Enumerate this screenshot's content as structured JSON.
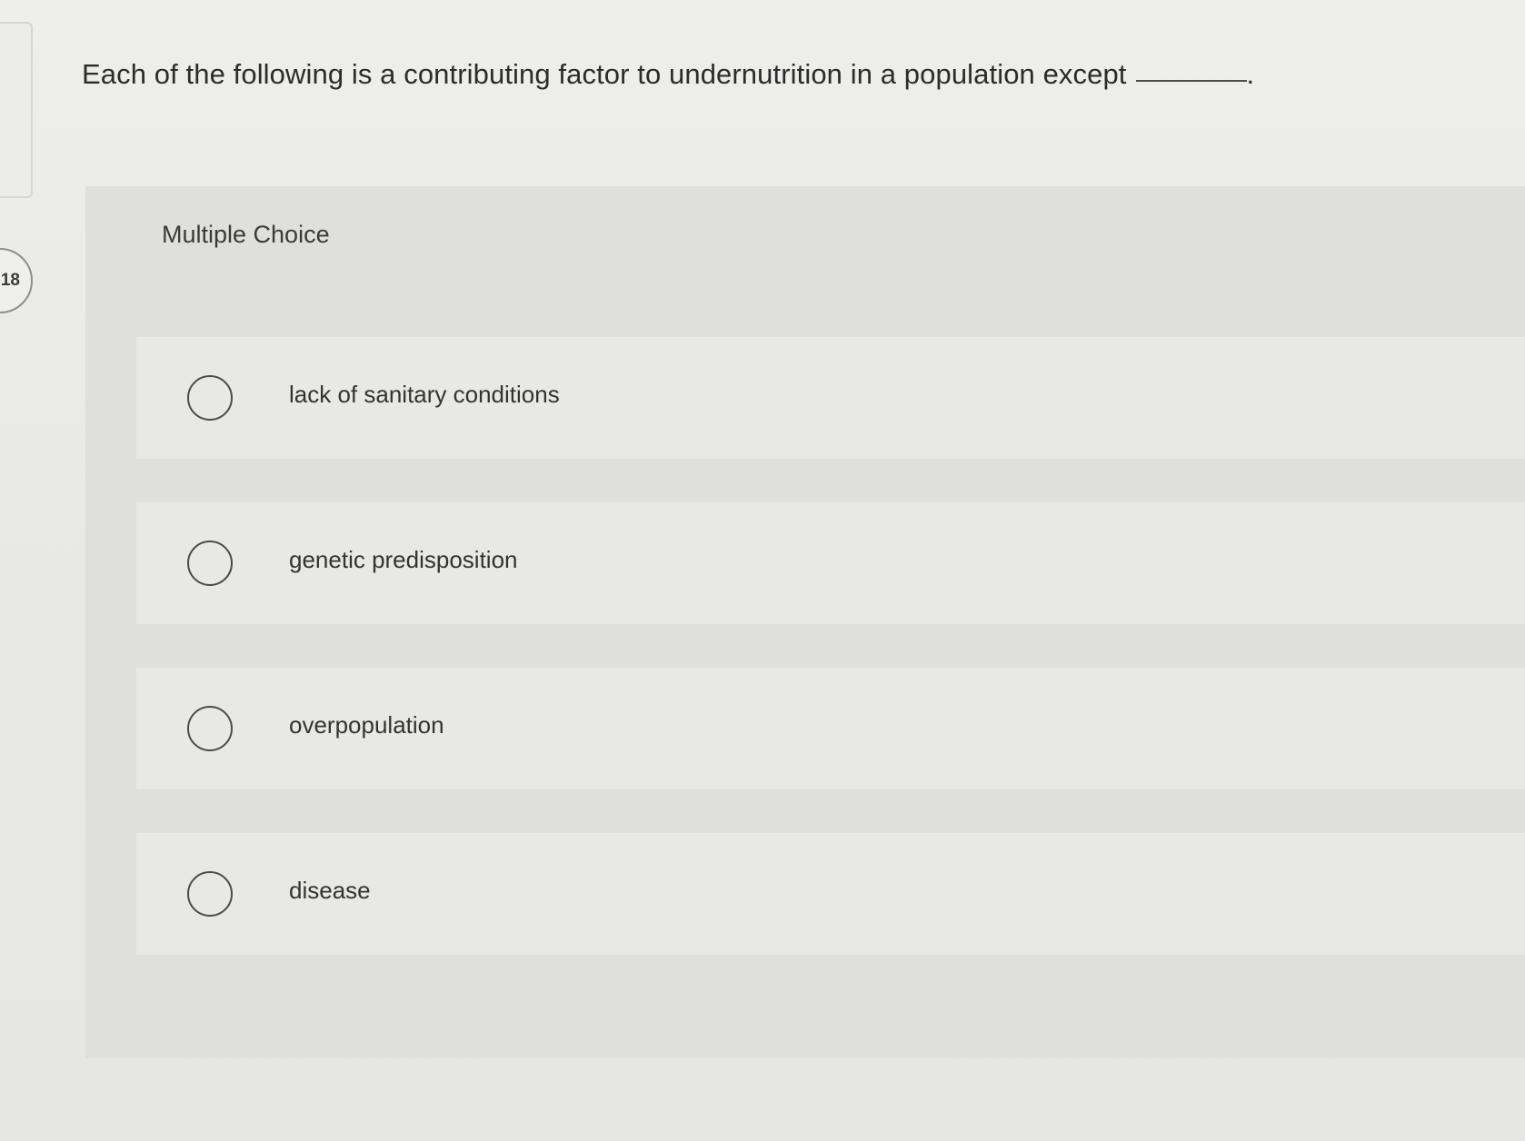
{
  "question": {
    "number": "18",
    "text": "Each of the following is a contributing factor to undernutrition in a population except",
    "blank_suffix": "."
  },
  "answer_section": {
    "heading": "Multiple Choice",
    "options": [
      {
        "label": "lack of sanitary conditions",
        "selected": false
      },
      {
        "label": "genetic predisposition",
        "selected": false
      },
      {
        "label": "overpopulation",
        "selected": false
      },
      {
        "label": "disease",
        "selected": false
      }
    ]
  },
  "icons": {
    "radio": "radio-unchecked-icon"
  }
}
